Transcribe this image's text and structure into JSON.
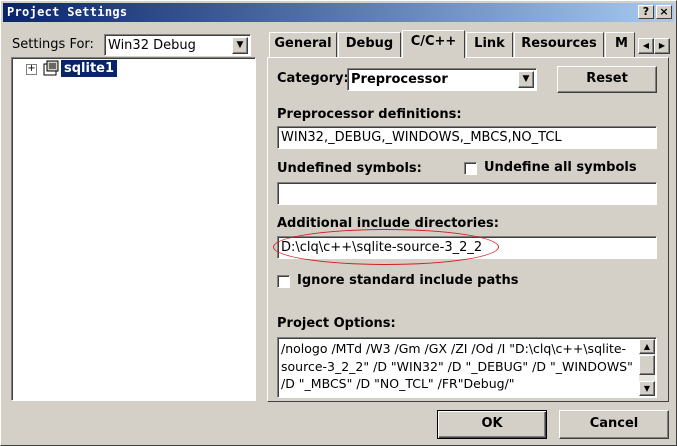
{
  "window": {
    "title": "Project Settings",
    "help_button": "?",
    "close_button": "×"
  },
  "left": {
    "settings_for_label": "Settings For:",
    "settings_for_value": "Win32 Debug",
    "tree": {
      "expander": "+",
      "project": "sqlite1",
      "project_icon": "project-icon"
    }
  },
  "tabs": [
    {
      "label": "General"
    },
    {
      "label": "Debug"
    },
    {
      "label": "C/C++"
    },
    {
      "label": "Link"
    },
    {
      "label": "Resources"
    },
    {
      "label": "M"
    }
  ],
  "active_tab": "C/C++",
  "tab_scroll": {
    "left": "◀",
    "right": "▶"
  },
  "panel": {
    "category_label": "Category:",
    "category_value": "Preprocessor",
    "reset_button": "Reset",
    "preproc_label": "Preprocessor definitions:",
    "preproc_value": "WIN32,_DEBUG,_WINDOWS,_MBCS,NO_TCL",
    "undefined_label": "Undefined symbols:",
    "undefined_value": "",
    "undefine_all_label": "Undefine all symbols",
    "undefine_all_checked": false,
    "include_label": "Additional include directories:",
    "include_value": "D:\\clq\\c++\\sqlite-source-3_2_2",
    "ignore_std_label": "Ignore standard include paths",
    "ignore_std_checked": false,
    "options_label": "Project Options:",
    "options_text": "/nologo /MTd /W3 /Gm /GX /ZI /Od /I \"D:\\clq\\c++\\sqlite-source-3_2_2\" /D \"WIN32\" /D \"_DEBUG\" /D \"_WINDOWS\" /D \"_MBCS\" /D \"NO_TCL\" /FR\"Debug/\""
  },
  "buttons": {
    "ok": "OK",
    "cancel": "Cancel"
  },
  "colors": {
    "titlebar_start": "#0a246a",
    "titlebar_end": "#a6caf0",
    "face": "#d4d0c8",
    "selection": "#0a246a",
    "annotation": "#d42020"
  }
}
